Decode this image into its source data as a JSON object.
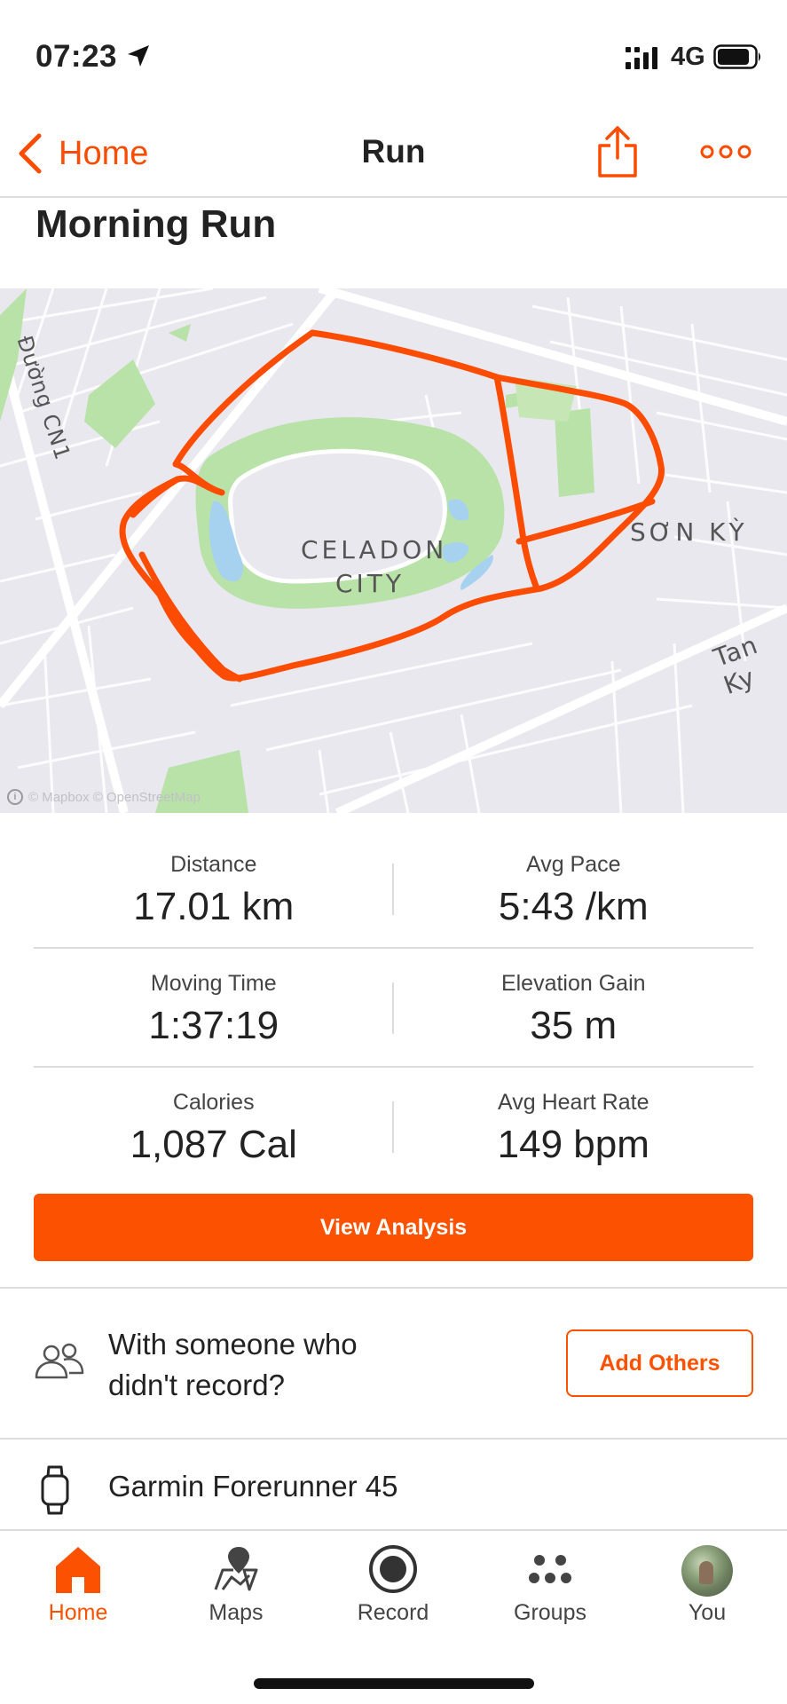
{
  "status_bar": {
    "time": "07:23",
    "network": "4G"
  },
  "nav": {
    "back_label": "Home",
    "title": "Run"
  },
  "activity": {
    "title": "Morning Run"
  },
  "map": {
    "labels": [
      "CELADON",
      "CITY",
      "SƠN KỲ",
      "Tan Ky",
      "Đường CN1"
    ],
    "attribution": "© Mapbox © OpenStreetMap",
    "route_color": "#fc4c02"
  },
  "stats": [
    [
      {
        "label": "Distance",
        "value": "17.01 km"
      },
      {
        "label": "Avg Pace",
        "value": "5:43 /km"
      }
    ],
    [
      {
        "label": "Moving Time",
        "value": "1:37:19"
      },
      {
        "label": "Elevation Gain",
        "value": "35 m"
      }
    ],
    [
      {
        "label": "Calories",
        "value": "1,087 Cal"
      },
      {
        "label": "Avg Heart Rate",
        "value": "149 bpm"
      }
    ]
  ],
  "analysis_button": "View Analysis",
  "with_others": {
    "text": "With someone who didn't record?",
    "button": "Add Others"
  },
  "device": {
    "name": "Garmin Forerunner 45"
  },
  "tabs": [
    {
      "label": "Home",
      "icon": "home-icon",
      "active": true
    },
    {
      "label": "Maps",
      "icon": "maps-icon",
      "active": false
    },
    {
      "label": "Record",
      "icon": "record-icon",
      "active": false
    },
    {
      "label": "Groups",
      "icon": "groups-icon",
      "active": false
    },
    {
      "label": "You",
      "icon": "avatar",
      "active": false
    }
  ],
  "colors": {
    "accent": "#fc5200",
    "park": "#b9e2a8",
    "water": "#a6d2f0"
  }
}
